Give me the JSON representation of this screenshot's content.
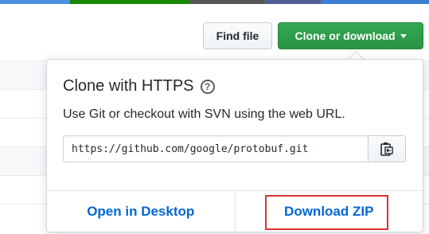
{
  "toolbar": {
    "find_file_label": "Find file",
    "clone_label": "Clone or download"
  },
  "clone_panel": {
    "title": "Clone with HTTPS",
    "help_icon": "?",
    "description": "Use Git or checkout with SVN using the web URL.",
    "url": "https://github.com/google/protobuf.git",
    "copy_icon": "clipboard-icon",
    "open_desktop_label": "Open in Desktop",
    "download_zip_label": "Download ZIP"
  },
  "colors": {
    "clone_button": "#2ea44f",
    "link": "#0366d6",
    "highlight": "#e0322d",
    "langbar": [
      "#3572A5",
      "#178600",
      "#555555",
      "#4F5D95",
      "#438eff"
    ]
  }
}
